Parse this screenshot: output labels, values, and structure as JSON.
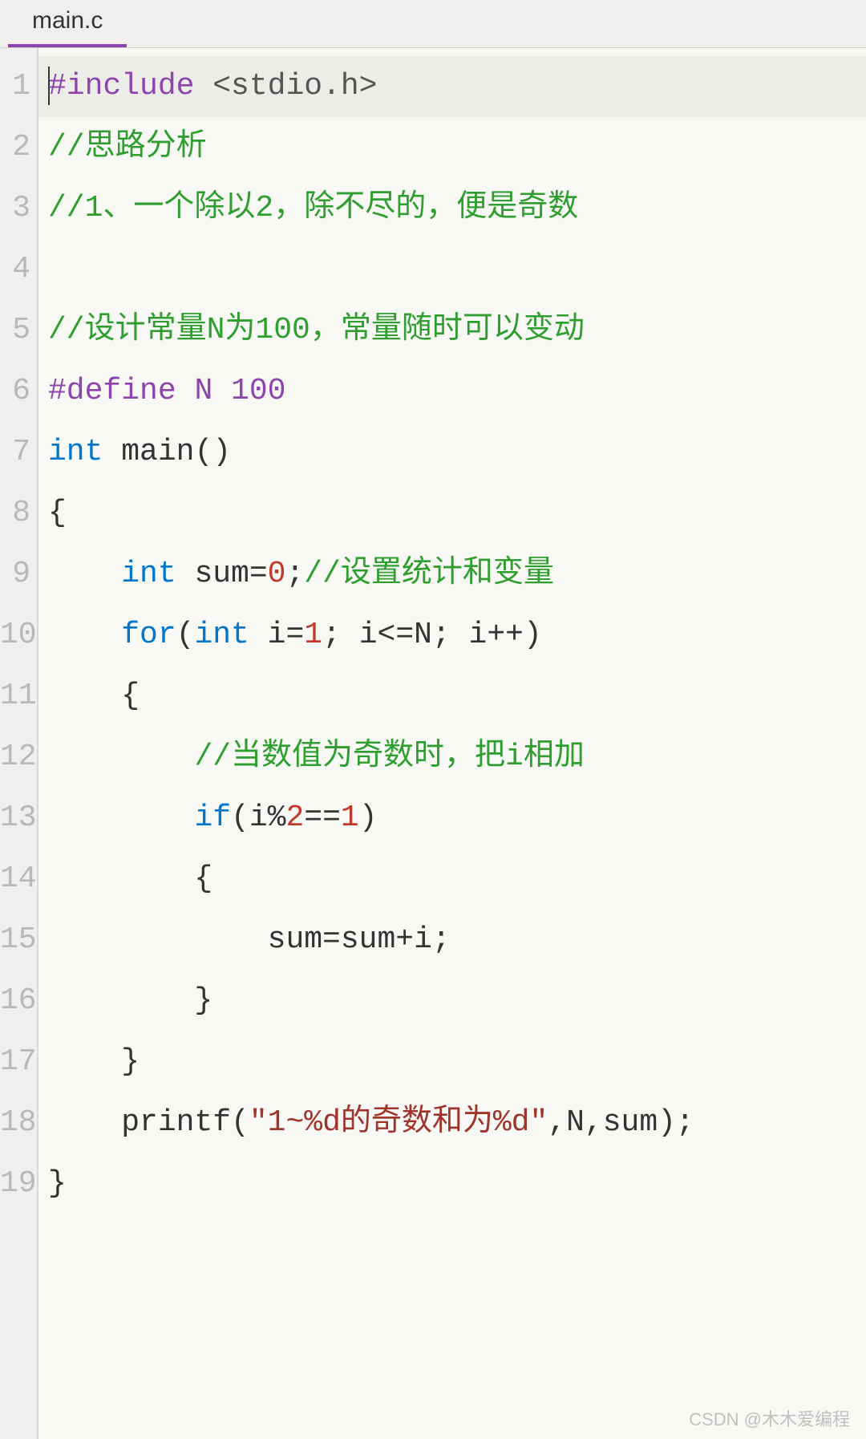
{
  "tab": {
    "name": "main.c"
  },
  "gutter": [
    "1",
    "2",
    "3",
    "4",
    "5",
    "6",
    "7",
    "8",
    "9",
    "10",
    "11",
    "12",
    "13",
    "14",
    "15",
    "16",
    "17",
    "18",
    "19"
  ],
  "tokens": {
    "l1_include": "#include ",
    "l1_header": "<stdio.h>",
    "l2_comment": "//思路分析",
    "l3_comment": "//1、一个除以2，除不尽的，便是奇数",
    "l5_comment": "//设计常量N为100，常量随时可以变动",
    "l6_define": "#define ",
    "l6_name": "N ",
    "l6_val": "100",
    "l7_int": "int",
    "l7_main": " main()",
    "l8_brace": "{",
    "l9_indent": "    ",
    "l9_int": "int",
    "l9_sum": " sum=",
    "l9_zero": "0",
    "l9_semi": ";",
    "l9_comment": "//设置统计和变量",
    "l10_indent": "    ",
    "l10_for": "for",
    "l10_open": "(",
    "l10_int": "int",
    "l10_init": " i=",
    "l10_one": "1",
    "l10_cond": "; i<=N; i++)",
    "l11_brace": "    {",
    "l12_indent": "        ",
    "l12_comment": "//当数值为奇数时，把i相加",
    "l13_indent": "        ",
    "l13_if": "if",
    "l13_open": "(i%",
    "l13_two": "2",
    "l13_eq": "==",
    "l13_one": "1",
    "l13_close": ")",
    "l14_brace": "        {",
    "l15_stmt": "            sum=sum+i;",
    "l16_brace": "        }",
    "l17_brace": "    }",
    "l18_indent": "    ",
    "l18_printf": "printf(",
    "l18_str": "\"1~%d的奇数和为%d\"",
    "l18_args": ",N,sum);",
    "l19_brace": "}"
  },
  "watermark": "CSDN @木木爱编程"
}
